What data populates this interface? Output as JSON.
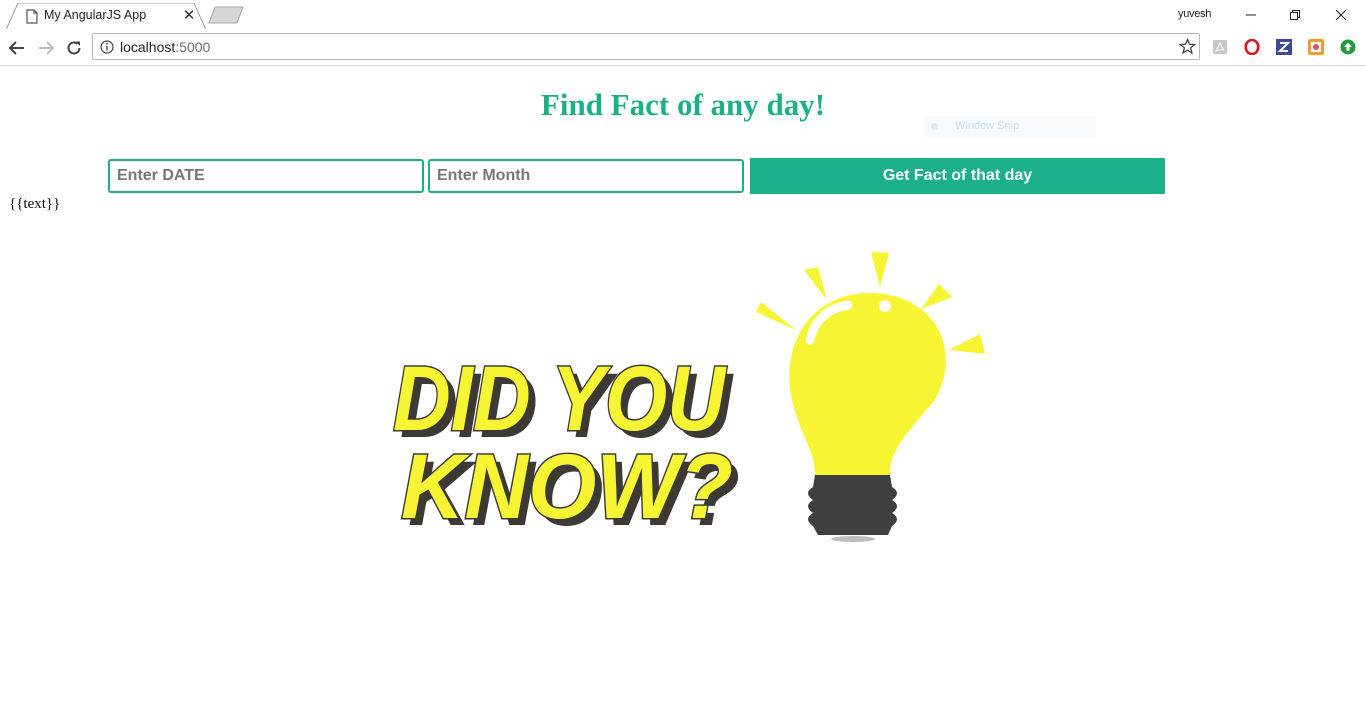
{
  "browser": {
    "tab_title": "My AngularJS App",
    "profile_name": "yuvesh",
    "url_host": "localhost",
    "url_port": ":5000"
  },
  "page": {
    "heading": "Find Fact of any day!",
    "snip_overlay": "Window Snip",
    "date_placeholder": "Enter DATE",
    "month_placeholder": "Enter Month",
    "submit_label": "Get Fact of that day",
    "output_text": "{{text}}",
    "image_alt": "Did you know?",
    "image_line1": "DID YOU",
    "image_line2": "KNOW?"
  },
  "colors": {
    "accent": "#1bb088",
    "bulb": "#f7f433",
    "outline": "#3d3a36"
  }
}
